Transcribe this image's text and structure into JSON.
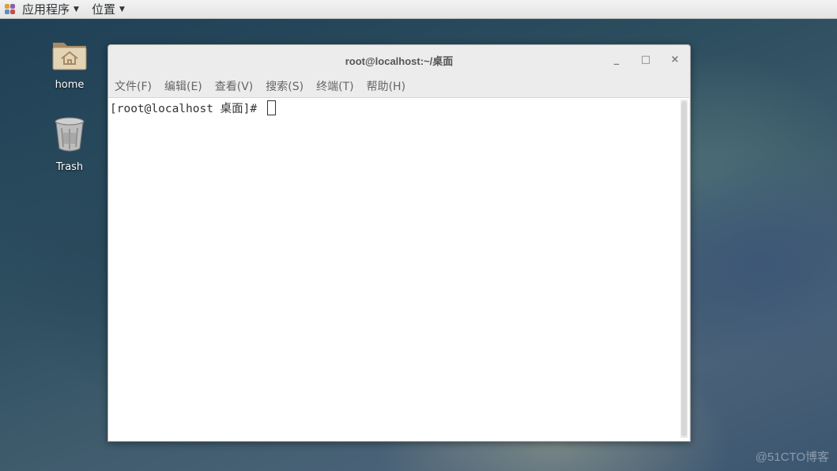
{
  "topbar": {
    "applications_label": "应用程序",
    "places_label": "位置"
  },
  "desktop": {
    "icons": [
      {
        "label": "home",
        "icon": "home-folder-icon"
      },
      {
        "label": "Trash",
        "icon": "trash-icon"
      }
    ]
  },
  "window": {
    "title": "root@localhost:~/桌面",
    "controls": {
      "minimize": "_",
      "maximize": "□",
      "close": "×"
    },
    "menu": [
      {
        "label": "文件(F)"
      },
      {
        "label": "编辑(E)"
      },
      {
        "label": "查看(V)"
      },
      {
        "label": "搜索(S)"
      },
      {
        "label": "终端(T)"
      },
      {
        "label": "帮助(H)"
      }
    ],
    "terminal": {
      "prompt": "[root@localhost 桌面]# "
    }
  },
  "watermark": "@51CTO博客"
}
